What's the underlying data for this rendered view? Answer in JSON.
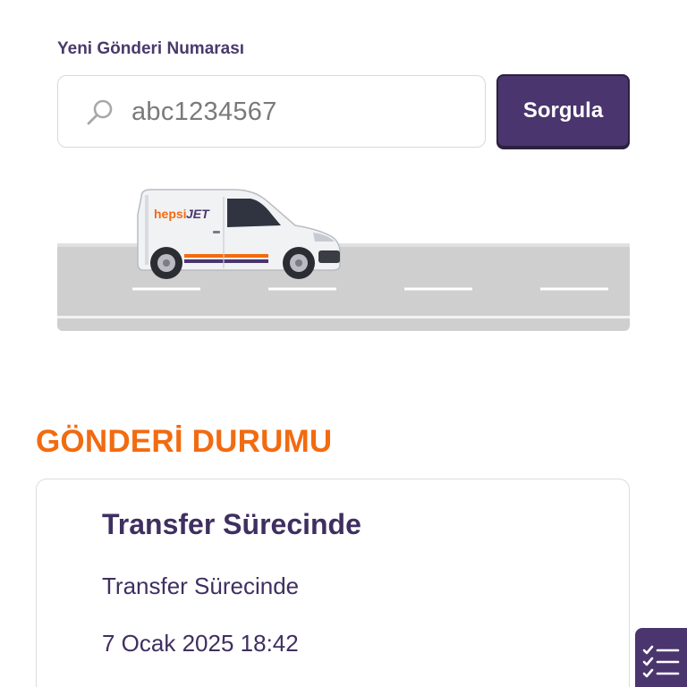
{
  "form": {
    "label": "Yeni Gönderi Numarası",
    "input_value": "abc1234567",
    "button_label": "Sorgula"
  },
  "illustration": {
    "van_brand": "hepsiJET"
  },
  "status": {
    "heading": "GÖNDERİ DURUMU",
    "title": "Transfer Sürecinde",
    "description": "Transfer Sürecinde",
    "date": "7 Ocak 2025 18:42"
  },
  "icons": {
    "search": "search-icon",
    "checklist": "checklist-icon"
  },
  "colors": {
    "brand_purple": "#4a356e",
    "accent_orange": "#f26b10",
    "text_purple": "#3f2f60"
  }
}
